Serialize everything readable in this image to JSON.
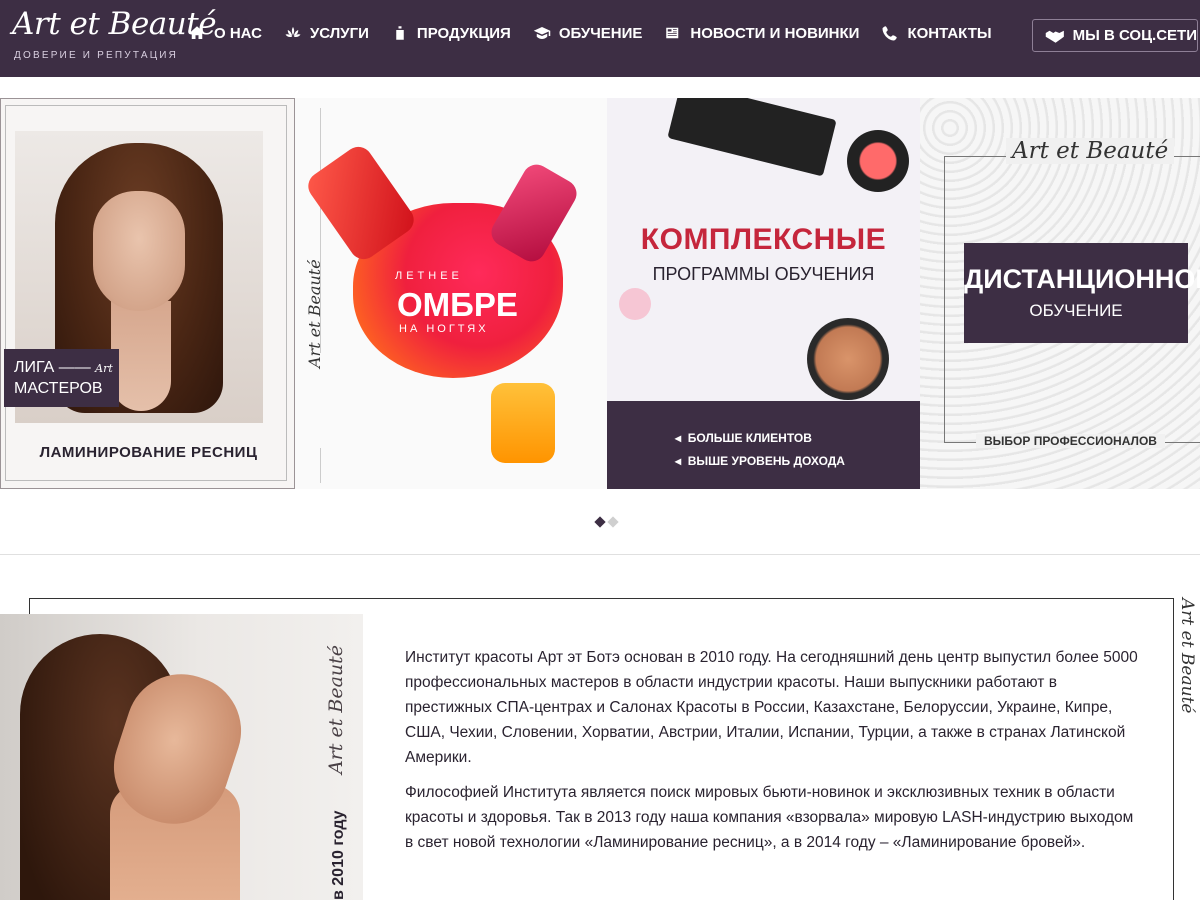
{
  "brand": {
    "logo_text": "Art et Beauté",
    "tagline": "ДОВЕРИЕ И РЕПУТАЦИЯ"
  },
  "nav": {
    "items": [
      {
        "label": "О НАС",
        "icon": "home-icon"
      },
      {
        "label": "УСЛУГИ",
        "icon": "lotus-icon"
      },
      {
        "label": "ПРОДУКЦИЯ",
        "icon": "bottle-icon"
      },
      {
        "label": "ОБУЧЕНИЕ",
        "icon": "graduation-cap-icon"
      },
      {
        "label": "НОВОСТИ И НОВИНКИ",
        "icon": "newspaper-icon"
      },
      {
        "label": "КОНТАКТЫ",
        "icon": "phone-icon"
      }
    ],
    "social_label": "МЫ В СОЦ.СЕТИ",
    "social_icon": "handshake-icon"
  },
  "slider": {
    "slide1": {
      "badge_line1": "ЛИГА",
      "badge_art": "Art",
      "badge_line2": "МАСТЕРОВ",
      "caption": "ЛАМИНИРОВАНИЕ РЕСНИЦ"
    },
    "slide2": {
      "side_logo": "Art et Beauté",
      "line1": "ЛЕТНЕЕ",
      "line2": "ОМБРЕ",
      "line3": "НА НОГТЯХ"
    },
    "slide3": {
      "title": "КОМПЛЕКСНЫЕ",
      "subtitle": "ПРОГРАММЫ ОБУЧЕНИЯ",
      "bullet1": "БОЛЬШЕ КЛИЕНТОВ",
      "bullet2": "ВЫШЕ УРОВЕНЬ ДОХОДА"
    },
    "slide4": {
      "logo": "Art et Beauté",
      "title": "ДИСТАНЦИОННОЕ",
      "subtitle": "ОБУЧЕНИЕ",
      "footer": "ВЫБОР ПРОФЕССИОНАЛОВ"
    },
    "active_dot": 1,
    "dot_count": 2
  },
  "about": {
    "side_logo": "Art et Beauté",
    "photo_logo": "Art et Beauté",
    "photo_year": "в 2010 году",
    "paragraph1": "Институт красоты Арт эт Ботэ основан в 2010 году. На сегодняшний день центр выпустил более 5000 профессиональных мастеров в области индустрии красоты. Наши выпускники работают в престижных СПА-центрах и Салонах Красоты в России, Казахстане, Белоруссии, Украине, Кипре, США, Чехии, Словении, Хорватии, Австрии, Италии, Испании, Турции, а также в странах Латинской Америки.",
    "paragraph2": "Философией Института является поиск мировых бьюти-новинок и эксклюзивных техник в области красоты и здоровья. Так в 2013 году наша компания «взорвала» мировую LASH-индустрию выходом в свет новой технологии «Ламинирование ресниц», а в 2014 году – «Ламинирование бровей»."
  },
  "colors": {
    "brand_purple": "#3d2e44",
    "accent_red": "#c5263c"
  }
}
